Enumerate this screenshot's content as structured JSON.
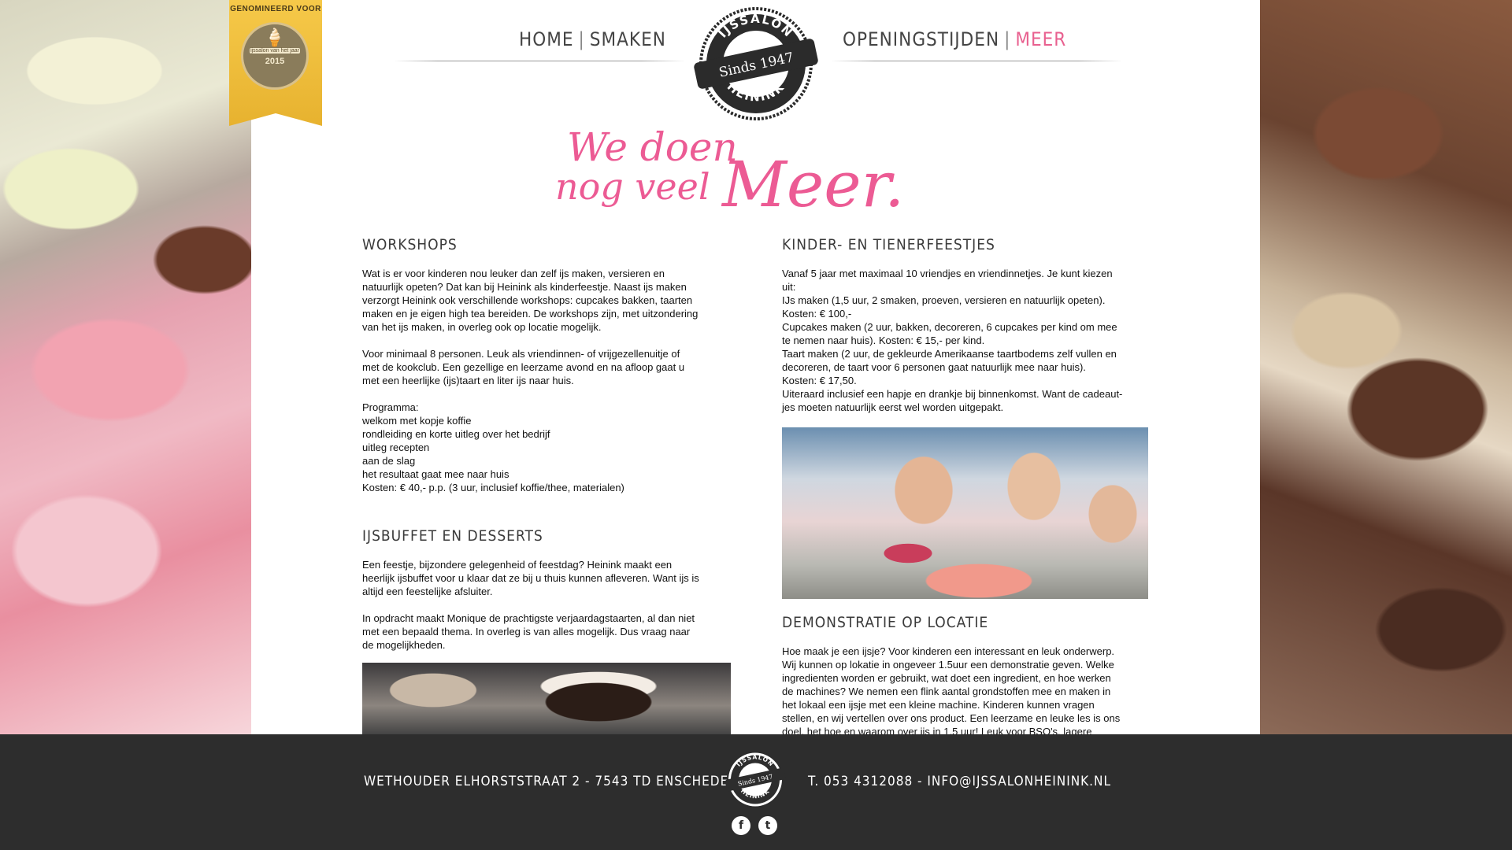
{
  "nav": {
    "home": "HOME",
    "smaken": "SMAKEN",
    "openingstijden": "OPENINGSTIJDEN",
    "meer": "MEER",
    "separator": "|"
  },
  "ribbon": {
    "text": "GENOMINEERD VOOR",
    "subtitle": "ijssalon van het jaar",
    "year": "2015"
  },
  "logo": {
    "top": "IJSSALON",
    "middle": "Sinds 1947",
    "bottom": "HEININK"
  },
  "headline": {
    "line1": "We doen",
    "line2": "nog veel",
    "line3": "Meer."
  },
  "sections": {
    "workshops": {
      "title": "WORKSHOPS",
      "p1": "Wat is er voor kinderen nou leuker dan zelf ijs maken, versieren en\nnatuurlijk opeten? Dat kan bij Heinink als kinderfeestje. Naast ijs maken\nverzorgt Heinink ook verschillende workshops: cupcakes bakken, taarten\nmaken en je eigen high tea bereiden. De workshops zijn, met uitzondering\nvan het ijs maken, in overleg ook op locatie mogelijk.",
      "p2": "Voor minimaal 8 personen. Leuk als vriendinnen- of vrijgezellenuitje of\nmet de kookclub. Een gezellige en leerzame avond en na afloop gaat u\nmet een heerlijke (ijs)taart en liter ijs naar huis.",
      "p3": "Programma:\nwelkom met kopje koffie\nrondleiding en korte uitleg over het bedrijf\nuitleg recepten\naan de slag\nhet resultaat gaat mee naar huis\nKosten: € 40,- p.p. (3 uur, inclusief koffie/thee, materialen)"
    },
    "ijsbuffet": {
      "title": "IJSBUFFET EN DESSERTS",
      "p1": "Een feestje, bijzondere gelegenheid of feestdag? Heinink maakt een\nheerlijk ijsbuffet voor u klaar dat ze bij u thuis kunnen afleveren. Want ijs is\naltijd een feestelijke afsluiter.",
      "p2": "In opdracht maakt Monique de prachtigste verjaardagstaarten, al dan niet\nmet een bepaald thema. In overleg is van alles mogelijk. Dus vraag naar\nde mogelijkheden."
    },
    "kinder": {
      "title": "KINDER- EN TIENERFEESTJES",
      "p1": "Vanaf 5 jaar met maximaal 10 vriendjes en vriendinnetjes. Je kunt kiezen\nuit:\nIJs maken (1,5 uur, 2 smaken, proeven, versieren en natuurlijk opeten).\nKosten: € 100,-\nCupcakes maken (2 uur, bakken, decoreren, 6 cupcakes per kind om mee\nte nemen naar huis). Kosten: € 15,- per kind.\nTaart maken (2 uur, de gekleurde Amerikaanse taartbodems zelf vullen en\ndecoreren, de taart voor 6 personen gaat natuurlijk mee naar huis).\nKosten: € 17,50.\nUiteraard inclusief een hapje en drankje bij binnenkomst. Want de cadeaut-\njes moeten natuurlijk eerst wel worden uitgepakt."
    },
    "demonstratie": {
      "title": "DEMONSTRATIE OP LOCATIE",
      "p1": "Hoe maak je een ijsje? Voor kinderen een interessant en leuk onderwerp.\nWij kunnen op lokatie in ongeveer 1.5uur een demonstratie geven. Welke\ningredienten worden er gebruikt, wat doet een ingredient, en hoe werken\nde machines? We nemen een flink aantal grondstoffen mee en maken in\nhet lokaal een ijsje met een kleine machine. Kinderen kunnen vragen\nstellen, en wij vertellen over ons product. Een leerzame en leuke les is ons\ndoel, het hoe en waarom over ijs in 1,5 uur! Leuk voor BSO's, lagere"
    }
  },
  "footer": {
    "address": "WETHOUDER ELHORSTSTRAAT 2 - 7543 TD ENSCHEDE",
    "contact": "T. 053 4312088 - INFO@IJSSALONHEININK.NL",
    "facebook_icon": "f",
    "twitter_icon": "t"
  },
  "colors": {
    "accent": "#ec5b94",
    "footer_bg": "#2d2d2d",
    "ribbon": "#f6c949"
  }
}
